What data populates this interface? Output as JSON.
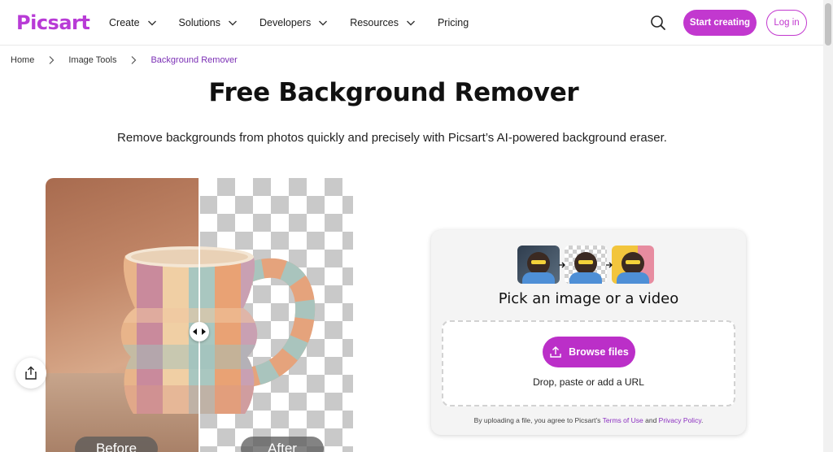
{
  "brand": {
    "logo_text": "Picsart",
    "accent": "#c238cf"
  },
  "header": {
    "nav": [
      {
        "label": "Create",
        "icon": "chevron-down-icon"
      },
      {
        "label": "Solutions",
        "icon": "chevron-down-icon"
      },
      {
        "label": "Developers",
        "icon": "chevron-down-icon"
      },
      {
        "label": "Resources",
        "icon": "chevron-down-icon"
      },
      {
        "label": "Pricing"
      }
    ],
    "search_icon": "search-icon",
    "start_label": "Start creating",
    "login_label": "Log in"
  },
  "breadcrumb": [
    {
      "label": "Home"
    },
    {
      "label": "Image Tools"
    },
    {
      "label": "Background Remover"
    }
  ],
  "hero": {
    "title": "Free Background Remover",
    "subtitle": "Remove backgrounds from photos quickly and precisely with Picsart’s AI-powered background eraser."
  },
  "compare": {
    "before_label": "Before",
    "after_label": "After"
  },
  "share_icon": "share-icon",
  "upload": {
    "title": "Pick an image or a video",
    "browse_label": "Browse files",
    "drop_text": "Drop, paste or add a URL",
    "terms_prefix": "By uploading a file, you agree to Picsart’s",
    "terms_link": "Terms of Use",
    "terms_and": "and",
    "privacy_link": "Privacy Policy",
    "terms_suffix": "."
  }
}
